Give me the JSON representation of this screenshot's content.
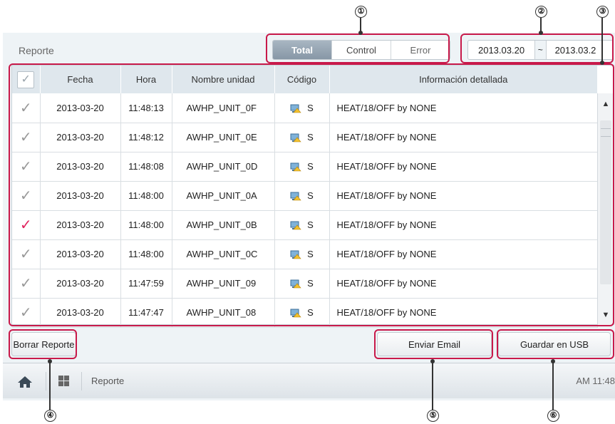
{
  "header": {
    "title": "Reporte"
  },
  "filter_tabs": [
    {
      "label": "Total",
      "active": true
    },
    {
      "label": "Control",
      "active": false
    },
    {
      "label": "Error",
      "active": false
    }
  ],
  "date_range": {
    "from": "2013.03.20",
    "separator": "~",
    "to": "2013.03.2"
  },
  "table": {
    "headers": [
      "Fecha",
      "Hora",
      "Nombre unidad",
      "Código",
      "Información detallada"
    ],
    "rows": [
      {
        "checked": false,
        "fecha": "2013-03-20",
        "hora": "11:48:13",
        "unidad": "AWHP_UNIT_0F",
        "codigo": "S",
        "info": "HEAT/18/OFF by NONE"
      },
      {
        "checked": false,
        "fecha": "2013-03-20",
        "hora": "11:48:12",
        "unidad": "AWHP_UNIT_0E",
        "codigo": "S",
        "info": "HEAT/18/OFF by NONE"
      },
      {
        "checked": false,
        "fecha": "2013-03-20",
        "hora": "11:48:08",
        "unidad": "AWHP_UNIT_0D",
        "codigo": "S",
        "info": "HEAT/18/OFF by NONE"
      },
      {
        "checked": false,
        "fecha": "2013-03-20",
        "hora": "11:48:00",
        "unidad": "AWHP_UNIT_0A",
        "codigo": "S",
        "info": "HEAT/18/OFF by NONE"
      },
      {
        "checked": true,
        "fecha": "2013-03-20",
        "hora": "11:48:00",
        "unidad": "AWHP_UNIT_0B",
        "codigo": "S",
        "info": "HEAT/18/OFF by NONE"
      },
      {
        "checked": false,
        "fecha": "2013-03-20",
        "hora": "11:48:00",
        "unidad": "AWHP_UNIT_0C",
        "codigo": "S",
        "info": "HEAT/18/OFF by NONE"
      },
      {
        "checked": false,
        "fecha": "2013-03-20",
        "hora": "11:47:59",
        "unidad": "AWHP_UNIT_09",
        "codigo": "S",
        "info": "HEAT/18/OFF by NONE"
      },
      {
        "checked": false,
        "fecha": "2013-03-20",
        "hora": "11:47:47",
        "unidad": "AWHP_UNIT_08",
        "codigo": "S",
        "info": "HEAT/18/OFF by NONE"
      }
    ]
  },
  "buttons": {
    "delete_report": "Borrar Reporte",
    "send_email": "Enviar Email",
    "save_usb": "Guardar en USB"
  },
  "taskbar": {
    "home_icon": "home-icon",
    "menu_icon": "grid-icon",
    "label": "Reporte",
    "clock": "AM 11:48"
  },
  "callouts": [
    "①",
    "②",
    "③",
    "④",
    "⑤",
    "⑥"
  ],
  "colors": {
    "highlight": "#c8194a",
    "check_active": "#e0245e",
    "tab_active": "#8797a6"
  }
}
